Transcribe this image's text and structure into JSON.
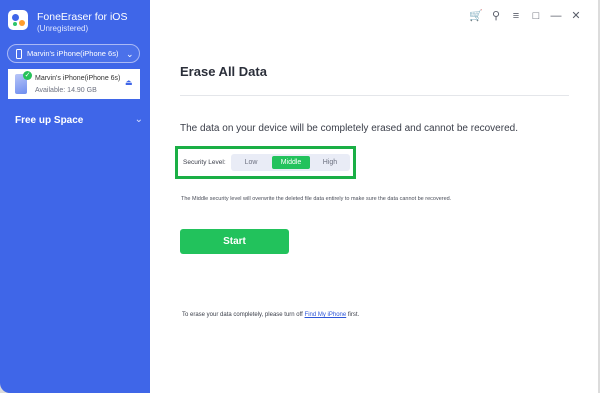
{
  "app": {
    "title": "FoneEraser for iOS",
    "subtitle": "(Unregistered)"
  },
  "device_select": {
    "label": "Marvin's iPhone(iPhone 6s)"
  },
  "device_card": {
    "name": "Marvin's iPhone(iPhone 6s)",
    "available": "Available: 14.90 GB"
  },
  "nav": {
    "free_up_space": "Free up Space"
  },
  "toolbar_icons": [
    "cart-icon",
    "key-icon",
    "menu-icon",
    "feedback-icon",
    "minimize-icon",
    "close-icon"
  ],
  "main": {
    "title": "Erase All Data",
    "description": "The data on your device will be completely erased and cannot be recovered.",
    "security_label": "Security Level:",
    "levels": [
      "Low",
      "Middle",
      "High"
    ],
    "selected_level": "Middle",
    "note": "The Middle security level will overwrite the deleted file data entirely to make sure the data cannot be recovered.",
    "start_label": "Start",
    "footer_prefix": "To erase your data completely, please turn off",
    "footer_link": "Find My iPhone",
    "footer_suffix": "first."
  },
  "colors": {
    "sidebar": "#3f66e8",
    "accent_green": "#22c25c",
    "highlight_border": "#1aaf45",
    "link": "#2d56d8"
  }
}
